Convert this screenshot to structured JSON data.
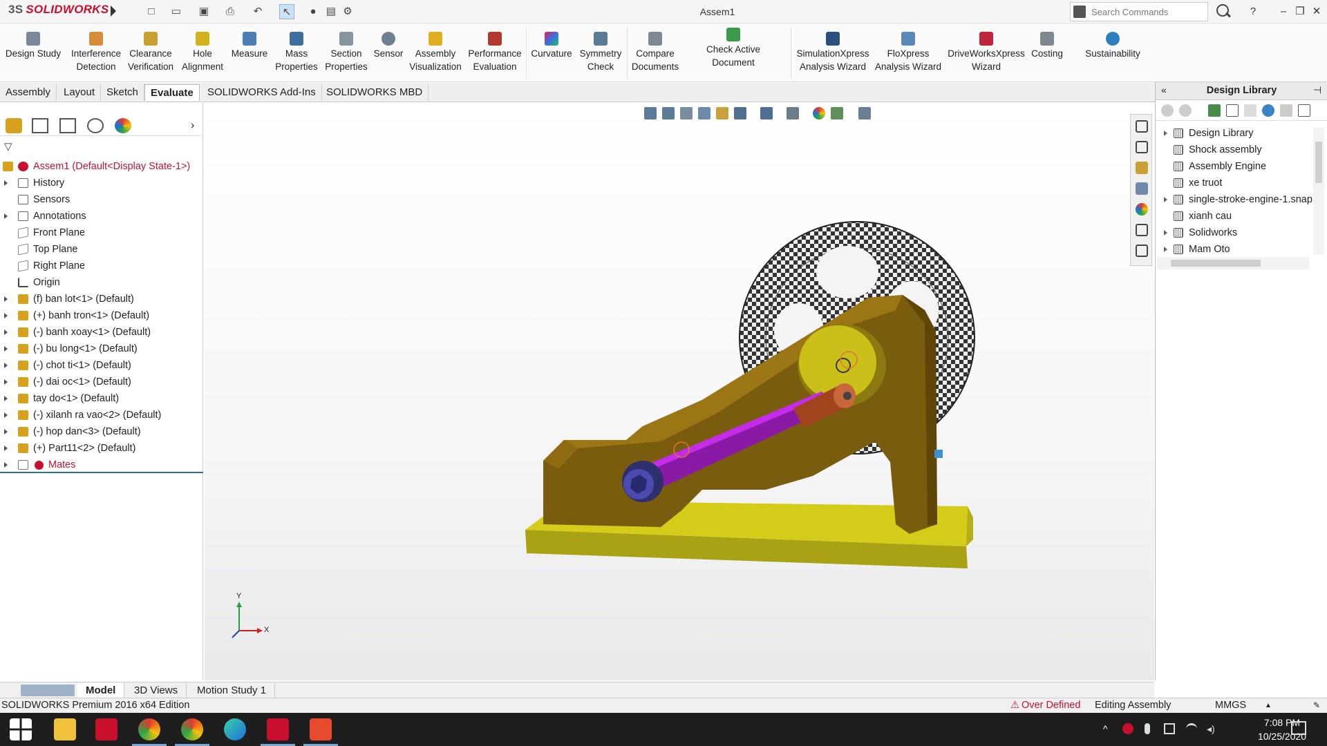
{
  "app": {
    "name": "SOLIDWORKS",
    "window_title": "Assem1"
  },
  "titlebar": {
    "search_placeholder": "Search Commands",
    "help": "?"
  },
  "ribbon": {
    "buttons": [
      {
        "label": "Design Study",
        "icon": "design-study-icon"
      },
      {
        "label": "Interference\nDetection",
        "icon": "interference-detection-icon"
      },
      {
        "label": "Clearance\nVerification",
        "icon": "clearance-verification-icon"
      },
      {
        "label": "Hole\nAlignment",
        "icon": "hole-alignment-icon"
      },
      {
        "label": "Measure",
        "icon": "measure-icon"
      },
      {
        "label": "Mass\nProperties",
        "icon": "mass-properties-icon"
      },
      {
        "label": "Section\nProperties",
        "icon": "section-properties-icon"
      },
      {
        "label": "Sensor",
        "icon": "sensor-icon"
      },
      {
        "label": "Assembly\nVisualization",
        "icon": "assembly-visualization-icon"
      },
      {
        "label": "Performance\nEvaluation",
        "icon": "performance-evaluation-icon"
      },
      {
        "label": "Curvature",
        "icon": "curvature-icon"
      },
      {
        "label": "Symmetry\nCheck",
        "icon": "symmetry-check-icon"
      },
      {
        "label": "Compare\nDocuments",
        "icon": "compare-documents-icon"
      },
      {
        "label": "Check Active Document",
        "icon": "check-active-document-icon"
      },
      {
        "label": "SimulationXpress\nAnalysis Wizard",
        "icon": "simulationxpress-icon"
      },
      {
        "label": "FloXpress\nAnalysis Wizard",
        "icon": "floxpress-icon"
      },
      {
        "label": "DriveWorksXpress\nWizard",
        "icon": "driveworksxpress-icon"
      },
      {
        "label": "Costing",
        "icon": "costing-icon"
      },
      {
        "label": "Sustainability",
        "icon": "sustainability-icon"
      }
    ]
  },
  "tabs": [
    "Assembly",
    "Layout",
    "Sketch",
    "Evaluate",
    "SOLIDWORKS Add-Ins",
    "SOLIDWORKS MBD"
  ],
  "active_tab": "Evaluate",
  "feature_tree": {
    "root": "Assem1  (Default<Display State-1>)",
    "items": [
      {
        "label": "History",
        "expandable": true
      },
      {
        "label": "Sensors",
        "expandable": false
      },
      {
        "label": "Annotations",
        "expandable": true
      },
      {
        "label": "Front Plane",
        "expandable": false
      },
      {
        "label": "Top Plane",
        "expandable": false
      },
      {
        "label": "Right Plane",
        "expandable": false
      },
      {
        "label": "Origin",
        "expandable": false
      },
      {
        "label": "(f) ban lot<1> (Default)",
        "expandable": true
      },
      {
        "label": "(+) banh tron<1> (Default)",
        "expandable": true
      },
      {
        "label": "(-) banh xoay<1> (Default)",
        "expandable": true
      },
      {
        "label": "(-) bu long<1> (Default)",
        "expandable": true
      },
      {
        "label": "(-) chot ti<1> (Default)",
        "expandable": true
      },
      {
        "label": "(-) dai oc<1> (Default)",
        "expandable": true
      },
      {
        "label": "tay do<1> (Default)",
        "expandable": true
      },
      {
        "label": "(-) xilanh ra vao<2> (Default)",
        "expandable": true
      },
      {
        "label": "(-) hop dan<3> (Default)",
        "expandable": true
      },
      {
        "label": "(+) Part11<2> (Default)",
        "expandable": true
      },
      {
        "label": "Mates",
        "expandable": true
      }
    ]
  },
  "triad": {
    "y": "Y",
    "x": "X"
  },
  "design_library": {
    "title": "Design Library",
    "items": [
      {
        "label": "Design Library",
        "expandable": true
      },
      {
        "label": "Shock assembly",
        "expandable": false
      },
      {
        "label": "Assembly Engine",
        "expandable": false
      },
      {
        "label": "xe truot",
        "expandable": false
      },
      {
        "label": "single-stroke-engine-1.snap",
        "expandable": true
      },
      {
        "label": "xianh cau",
        "expandable": false
      },
      {
        "label": "Solidworks",
        "expandable": true
      },
      {
        "label": "Mam Oto",
        "expandable": true
      }
    ]
  },
  "bottom_tabs": [
    "Model",
    "3D Views",
    "Motion Study 1"
  ],
  "status": {
    "edition": "SOLIDWORKS Premium 2016 x64 Edition",
    "warning": "Over Defined",
    "mode": "Editing Assembly",
    "units": "MMGS"
  },
  "taskbar": {
    "time": "7:08 PM",
    "date": "10/25/2020"
  },
  "colors": {
    "accent_red": "#c8102e",
    "part_gold": "#8b6a12",
    "base_yellow": "#c8c217",
    "rod_magenta": "#b11fd1"
  }
}
